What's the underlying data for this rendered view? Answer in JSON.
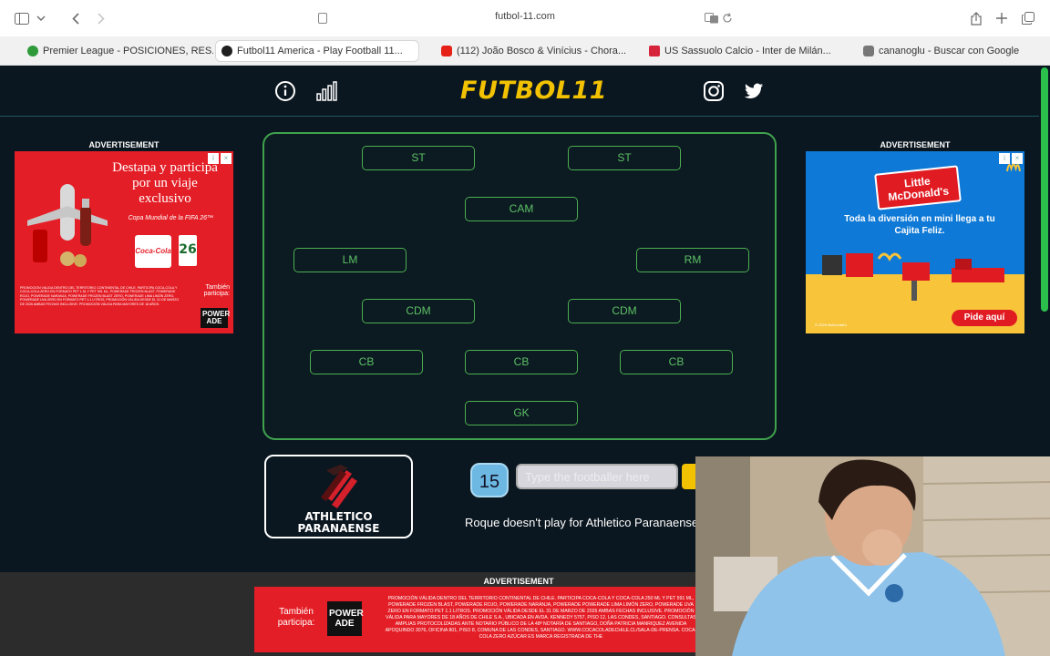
{
  "browser": {
    "url": "futbol-11.com",
    "tabs": [
      {
        "label": "Premier League - POSICIONES, RES...",
        "favicon_color": "#2e9a3a",
        "active": false
      },
      {
        "label": "Futbol11 America - Play Football 11...",
        "favicon_color": "#1f1f1f",
        "active": true
      },
      {
        "label": "(112) João Bosco & Vinícius - Chora...",
        "favicon_color": "#e62117",
        "active": false
      },
      {
        "label": "US Sassuolo Calcio - Inter de Milán...",
        "favicon_color": "#d6243a",
        "active": false
      },
      {
        "label": "cananoglu - Buscar con Google",
        "favicon_color": "#777777",
        "active": false
      }
    ]
  },
  "header": {
    "logo": "FUTBOL11",
    "icons": [
      "info-icon",
      "stats-icon",
      "instagram-icon",
      "twitter-icon"
    ]
  },
  "ads": {
    "label": "ADVERTISEMENT",
    "left": {
      "headline": "Destapa y participa por un viaje exclusivo",
      "sub": "Copa Mundial de la FIFA 26™",
      "brand": "Coca-Cola",
      "tambien": "También participa:",
      "powerade": "POWER ADE",
      "fine": "PROMOCIÓN VÁLIDA DENTRO DEL TERRITORIO CONTINENTAL DE CHILE. PARTICIPA COCA-COLA Y COCA-COLA ZERO EN FORMATO PET 1.5L Y PET 591 ML, POWERADE FROZEN BLAST, POWERADE ROJO, POWERADE NARANJA, POWERADE FROZEN BLAST ZERO, POWERADE LIMA LIMÓN ZERO, POWERADE UVA ZERO EN FORMATO PET 1.1 LITROS. PROMOCIÓN VÁLIDA DESDE EL 31 DE MARZO DE 2026 AMBAS FECHAS INCLUSIVE. PROMOCIÓN VÁLIDA PARA MAYORES DE 18 AÑOS."
    },
    "right": {
      "title": "Little McDonald's",
      "sub": "Toda la diversión en mini llega a tu Cajita Feliz.",
      "cta": "Pide aquí",
      "copyright": "© 2026 McDonald's"
    },
    "bottom": {
      "tambien": "También participa:",
      "powerade": "POWER ADE",
      "fine": "PROMOCIÓN VÁLIDA DENTRO DEL TERRITORIO CONTINENTAL DE CHILE. PARTICIPA COCA-COLA Y COCA-COLA 250 ML Y PET 591 ML, POWERADE FROZEN BLAST, POWERADE ROJO, POWERADE NARANJA, POWERADE POWERADE LIMA LIMÓN ZERO, POWERADE UVA ZERO EN FORMATO PET 1.1 LITROS. PROMOCIÓN VÁLIDA DESDE EL 31 DE MARZO DE 2026 AMBAS FECHAS INCLUSIVE. PROMOCIÓN VÁLIDA PARA MAYORES DE 18 AÑOS DE CHILE S.A., UBICADA EN AVDA. KENNEDY 5757, PISO 12, LAS CONDES, SANTIAGO. CONSULTAS AMPLIAS PROTOCOLIZADAS ANTE NOTARIO PÚBLICO DE LA 48ª NOTARÍA DE SANTIAGO, DOÑA PATRICIA MANRIQUEZ AVENIDA APOQUINDO 3076, OFICINA 801, PISO 8, COMUNA DE LAS CONDES, SANTIAGO. WWW.COCACOLADECHILE.CL/SALA-DE-PRENSA. COCA-COLA ZERO AZÚCAR ES MARCA REGISTRADA DE THE"
    }
  },
  "formation": {
    "positions": [
      "ST",
      "ST",
      "CAM",
      "LM",
      "RM",
      "CDM",
      "CDM",
      "CB",
      "CB",
      "CB",
      "GK"
    ]
  },
  "game": {
    "team_name_line1": "ATHLETICO",
    "team_name_line2": "PARANAENSE",
    "guesses_left": "15",
    "input_placeholder": "Type the footballer here",
    "message": "Roque doesn't play for Athletico Paranaense"
  }
}
